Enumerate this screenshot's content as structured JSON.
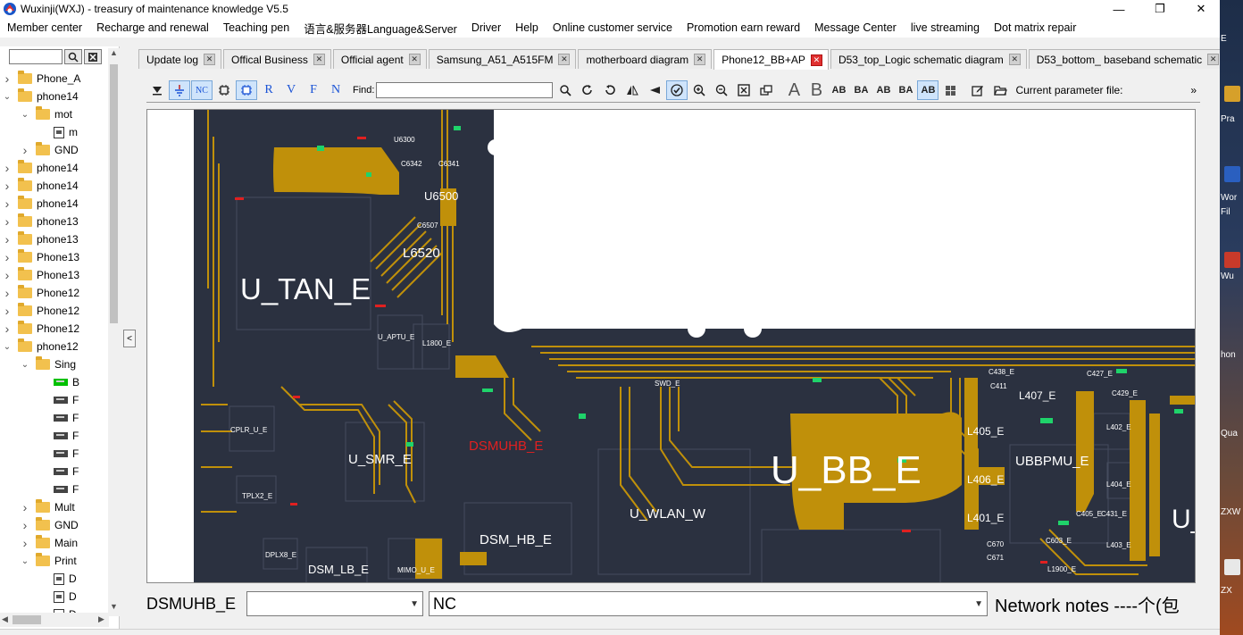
{
  "window": {
    "title": "Wuxinji(WXJ) - treasury of maintenance knowledge V5.5",
    "min": "—",
    "restore": "❐",
    "close": "✕"
  },
  "menu": [
    "Member center",
    "Recharge and renewal",
    "Teaching pen",
    "语言&服务器Language&Server",
    "Driver",
    "Help",
    "Online customer service",
    "Promotion earn reward",
    "Message Center",
    "live streaming",
    "Dot matrix repair"
  ],
  "tree": {
    "items": [
      {
        "label": "Phone_A",
        "kind": "folder",
        "state": "collapsed",
        "indent": 0
      },
      {
        "label": "phone14",
        "kind": "folder",
        "state": "expanded",
        "indent": 0
      },
      {
        "label": "mot",
        "kind": "folder",
        "state": "expanded",
        "indent": 1
      },
      {
        "label": "m",
        "kind": "doc",
        "state": "",
        "indent": 2
      },
      {
        "label": "GND",
        "kind": "folder",
        "state": "collapsed",
        "indent": 1
      },
      {
        "label": "phone14",
        "kind": "folder",
        "state": "collapsed",
        "indent": 0
      },
      {
        "label": "phone14",
        "kind": "folder",
        "state": "collapsed",
        "indent": 0
      },
      {
        "label": "phone14",
        "kind": "folder",
        "state": "collapsed",
        "indent": 0
      },
      {
        "label": "phone13",
        "kind": "folder",
        "state": "collapsed",
        "indent": 0
      },
      {
        "label": "phone13",
        "kind": "folder",
        "state": "collapsed",
        "indent": 0
      },
      {
        "label": "Phone13",
        "kind": "folder",
        "state": "collapsed",
        "indent": 0
      },
      {
        "label": "Phone13",
        "kind": "folder",
        "state": "collapsed",
        "indent": 0
      },
      {
        "label": "Phone12",
        "kind": "folder",
        "state": "collapsed",
        "indent": 0
      },
      {
        "label": "Phone12",
        "kind": "folder",
        "state": "collapsed",
        "indent": 0
      },
      {
        "label": "Phone12",
        "kind": "folder",
        "state": "collapsed",
        "indent": 0
      },
      {
        "label": "phone12",
        "kind": "folder",
        "state": "expanded",
        "indent": 0
      },
      {
        "label": "Sing",
        "kind": "folder",
        "state": "expanded",
        "indent": 1
      },
      {
        "label": "B",
        "kind": "pcb-selected",
        "state": "",
        "indent": 2
      },
      {
        "label": "F",
        "kind": "pcb",
        "state": "",
        "indent": 2
      },
      {
        "label": "F",
        "kind": "pcb",
        "state": "",
        "indent": 2
      },
      {
        "label": "F",
        "kind": "pcb",
        "state": "",
        "indent": 2
      },
      {
        "label": "F",
        "kind": "pcb",
        "state": "",
        "indent": 2
      },
      {
        "label": "F",
        "kind": "pcb",
        "state": "",
        "indent": 2
      },
      {
        "label": "F",
        "kind": "pcb",
        "state": "",
        "indent": 2
      },
      {
        "label": "Mult",
        "kind": "folder",
        "state": "collapsed",
        "indent": 1
      },
      {
        "label": "GND",
        "kind": "folder",
        "state": "collapsed",
        "indent": 1
      },
      {
        "label": "Main",
        "kind": "folder",
        "state": "collapsed",
        "indent": 1
      },
      {
        "label": "Print",
        "kind": "folder",
        "state": "expanded",
        "indent": 1
      },
      {
        "label": "D",
        "kind": "doc",
        "state": "",
        "indent": 2
      },
      {
        "label": "D",
        "kind": "doc",
        "state": "",
        "indent": 2
      },
      {
        "label": "D",
        "kind": "doc",
        "state": "",
        "indent": 2
      }
    ]
  },
  "tabs": [
    {
      "label": "Update log",
      "active": false
    },
    {
      "label": "Offical Business",
      "active": false
    },
    {
      "label": "Official agent",
      "active": false
    },
    {
      "label": "Samsung_A51_A515FM",
      "active": false
    },
    {
      "label": "motherboard diagram",
      "active": false
    },
    {
      "label": "Phone12_BB+AP",
      "active": true
    },
    {
      "label": "D53_top_Logic schematic diagram",
      "active": false
    },
    {
      "label": "D53_bottom_ baseband schematic",
      "active": false
    }
  ],
  "toolbar": {
    "find_label": "Find:",
    "find_value": "",
    "param_label": "Current parameter file:",
    "overflow": "»",
    "nc_label": "NC",
    "r_label": "R",
    "v_label": "V",
    "f_label": "F",
    "n_label": "N"
  },
  "board": {
    "labels": [
      {
        "text": "U6300",
        "size": "small"
      },
      {
        "text": "C6342",
        "size": "small"
      },
      {
        "text": "C6341",
        "size": "small"
      },
      {
        "text": "U6500",
        "size": "medium"
      },
      {
        "text": "C6507",
        "size": "small"
      },
      {
        "text": "L6520",
        "size": "medium"
      },
      {
        "text": "U_TAN_E",
        "size": "large"
      },
      {
        "text": "U_APTU_E",
        "size": "small"
      },
      {
        "text": "L1800_E",
        "size": "small"
      },
      {
        "text": "CPLR_U_E",
        "size": "small"
      },
      {
        "text": "U_SMR_E",
        "size": "medium"
      },
      {
        "text": "DSMUHB_E",
        "size": "medium-red"
      },
      {
        "text": "TPLX2_E",
        "size": "small"
      },
      {
        "text": "DSM_HB_E",
        "size": "medium"
      },
      {
        "text": "DPLX8_E",
        "size": "small"
      },
      {
        "text": "DSM_LB_E",
        "size": "medium"
      },
      {
        "text": "MIMO_U_E",
        "size": "small"
      },
      {
        "text": "U_WLAN_W",
        "size": "medium"
      },
      {
        "text": "U_BB_E",
        "size": "xlarge"
      },
      {
        "text": "UBBPMU_E",
        "size": "medium"
      },
      {
        "text": "L407_E",
        "size": "medium"
      },
      {
        "text": "L405_E",
        "size": "medium"
      },
      {
        "text": "L406_E",
        "size": "medium"
      },
      {
        "text": "L401_E",
        "size": "medium"
      },
      {
        "text": "C438_E",
        "size": "small"
      },
      {
        "text": "C411",
        "size": "small"
      },
      {
        "text": "C427_E",
        "size": "small"
      },
      {
        "text": "C429_E",
        "size": "small"
      },
      {
        "text": "L402_E",
        "size": "small"
      },
      {
        "text": "L404_E",
        "size": "small"
      },
      {
        "text": "C405_E",
        "size": "small"
      },
      {
        "text": "C431_E",
        "size": "small"
      },
      {
        "text": "C603_E",
        "size": "small"
      },
      {
        "text": "L403_E",
        "size": "small"
      },
      {
        "text": "C670",
        "size": "small"
      },
      {
        "text": "C671",
        "size": "small"
      },
      {
        "text": "L1900_E",
        "size": "small"
      },
      {
        "text": "SWD_E",
        "size": "small"
      },
      {
        "text": "U_",
        "size": "large"
      }
    ]
  },
  "bottom": {
    "net_name": "DSMUHB_E",
    "combo1_value": "",
    "combo2_value": "NC",
    "notes": "Network notes ----个(包"
  },
  "desktop": {
    "labels": [
      "E",
      "Pra",
      "Wor",
      "Fil",
      "Wu",
      "hon",
      "Qua",
      "ZXW",
      "ZX"
    ]
  },
  "colors": {
    "board_bg": "#2b3140",
    "copper": "#c0900a",
    "accent_green": "#1fd36a",
    "accent_red": "#e02020",
    "active_tab_close": "#e03030"
  }
}
